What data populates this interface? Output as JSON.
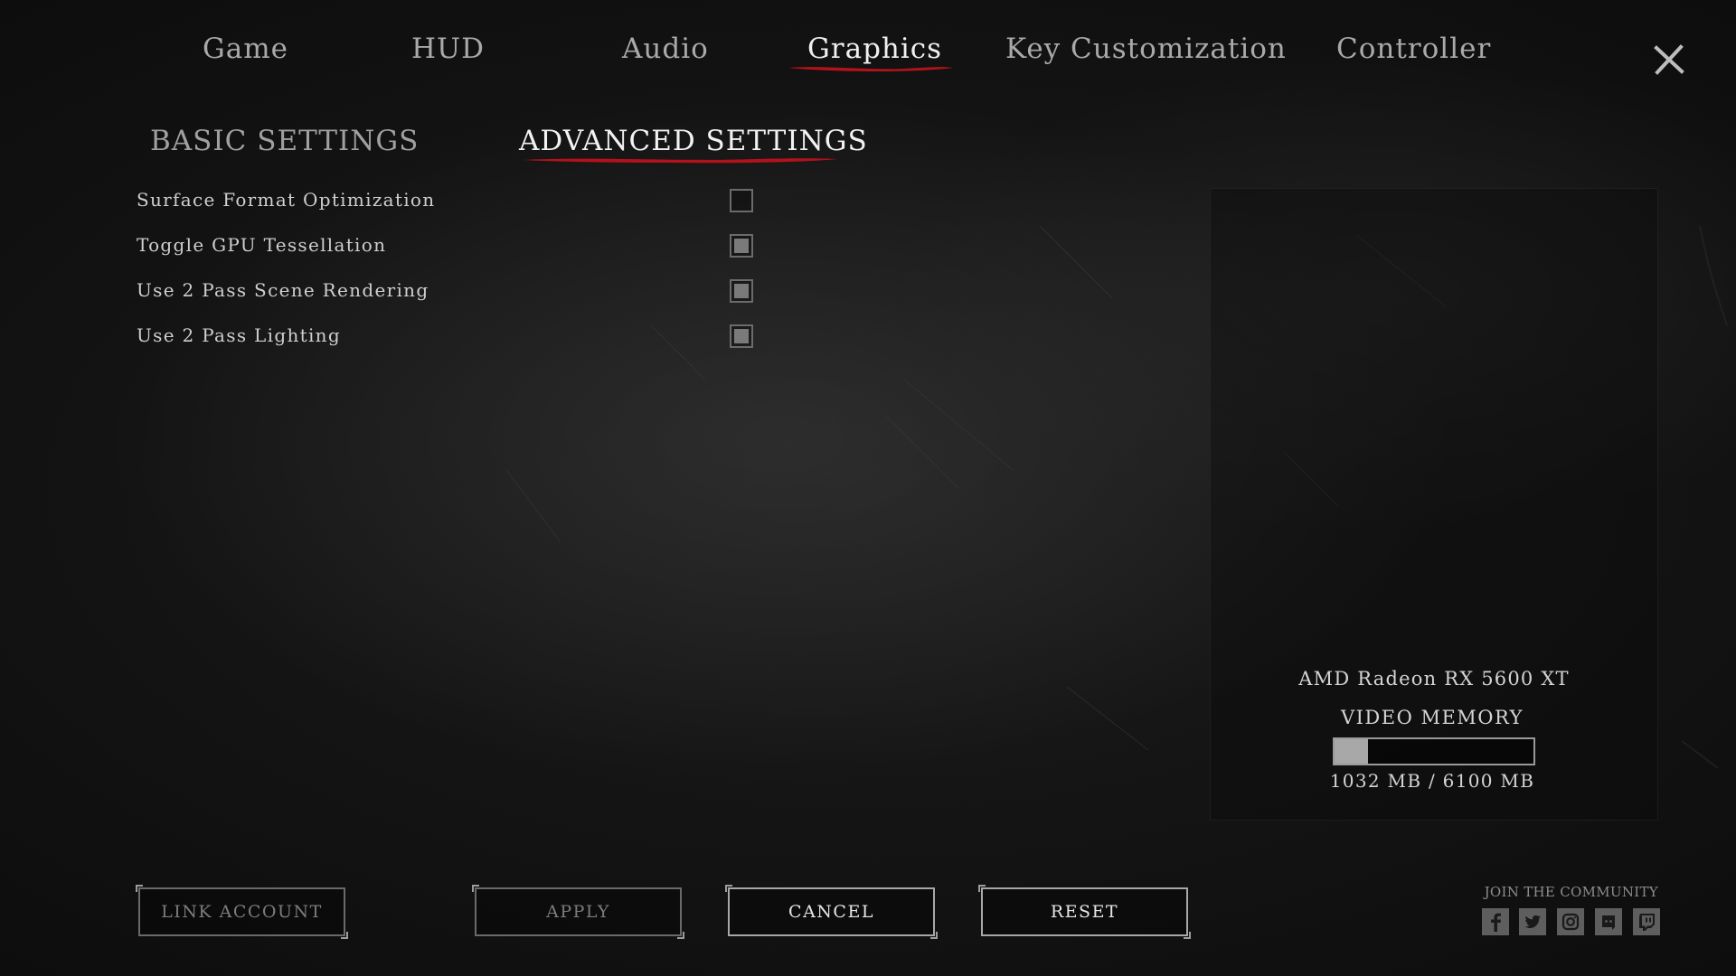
{
  "top_tabs": [
    {
      "label": "Game",
      "active": false
    },
    {
      "label": "HUD",
      "active": false
    },
    {
      "label": "Audio",
      "active": false
    },
    {
      "label": "Graphics",
      "active": true
    },
    {
      "label": "Key Customization",
      "active": false
    },
    {
      "label": "Controller",
      "active": false
    }
  ],
  "sub_tabs": [
    {
      "label": "BASIC SETTINGS",
      "active": false
    },
    {
      "label": "ADVANCED SETTINGS",
      "active": true
    }
  ],
  "settings": [
    {
      "label": "Surface Format Optimization",
      "checked": false
    },
    {
      "label": "Toggle GPU Tessellation",
      "checked": true
    },
    {
      "label": "Use 2 Pass Scene Rendering",
      "checked": true
    },
    {
      "label": "Use 2 Pass Lighting",
      "checked": true
    }
  ],
  "gpu": {
    "name": "AMD Radeon RX 5600 XT",
    "video_memory_label": "VIDEO MEMORY",
    "used_mb": 1032,
    "total_mb": 6100,
    "usage_text": "1032 MB / 6100 MB"
  },
  "buttons": {
    "link_account": "LINK ACCOUNT",
    "apply": "APPLY",
    "cancel": "CANCEL",
    "reset": "RESET"
  },
  "community": {
    "label": "JOIN THE COMMUNITY",
    "icons": [
      "facebook-icon",
      "twitter-icon",
      "instagram-icon",
      "discord-icon",
      "twitch-icon"
    ]
  },
  "colors": {
    "accent": "#b3121a",
    "background": "#111111",
    "text": "#d0d0d0"
  }
}
